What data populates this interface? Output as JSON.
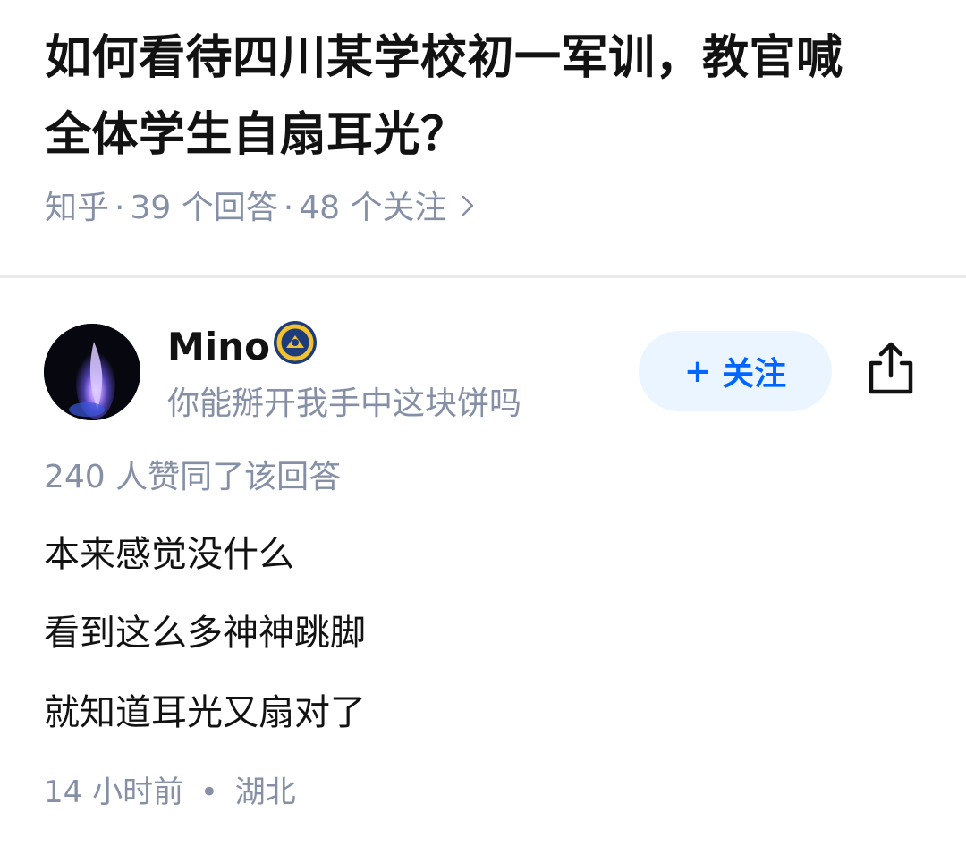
{
  "question": {
    "title_line1": "如何看待四川某学校初一军训，教官喊",
    "title_line2": "全体学生自扇耳光？",
    "source": "知乎",
    "answer_count": "39 个回答",
    "follower_count": "48 个关注",
    "separator": "·",
    "chevron_icon": "chevron-right-icon"
  },
  "author": {
    "name": "Mino",
    "bio": "你能掰开我手中这块饼吗",
    "avatar_icon": "avatar-purple-flame",
    "badge_icon": "verified-badge-icon"
  },
  "actions": {
    "follow_plus": "+",
    "follow_label": "关注",
    "share_icon": "share-icon"
  },
  "answer": {
    "upvote_text": "240 人赞同了该回答",
    "lines": [
      "本来感觉没什么",
      "看到这么多神神跳脚",
      "就知道耳光又扇对了"
    ],
    "time": "14 小时前",
    "footer_separator": "•",
    "location": "湖北"
  },
  "colors": {
    "text_primary": "#121212",
    "text_secondary": "#8590a6",
    "brand_blue": "#0066ff",
    "follow_bg": "#ebf5ff",
    "divider": "#ebebeb"
  }
}
